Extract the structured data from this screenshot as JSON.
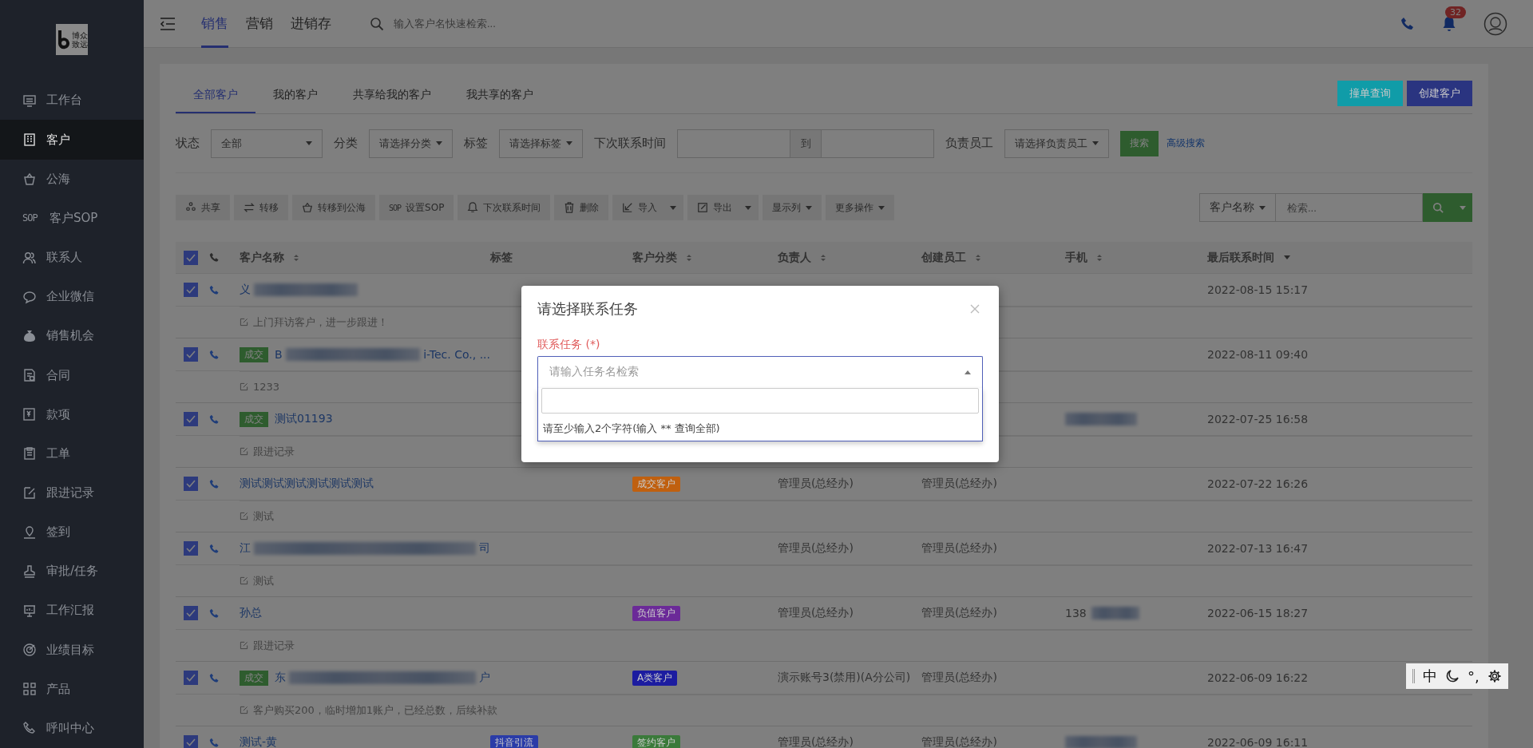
{
  "sidebar": {
    "logo_text": [
      "博众",
      "致远"
    ],
    "items": [
      {
        "label": "工作台",
        "selected": false
      },
      {
        "label": "客户",
        "selected": true
      },
      {
        "label": "公海",
        "selected": false
      },
      {
        "label": "客户SOP",
        "selected": false,
        "icon_text": "SOP"
      },
      {
        "label": "联系人",
        "selected": false
      },
      {
        "label": "企业微信",
        "selected": false
      },
      {
        "label": "销售机会",
        "selected": false
      },
      {
        "label": "合同",
        "selected": false
      },
      {
        "label": "款项",
        "selected": false
      },
      {
        "label": "工单",
        "selected": false
      },
      {
        "label": "跟进记录",
        "selected": false
      },
      {
        "label": "签到",
        "selected": false
      },
      {
        "label": "审批/任务",
        "selected": false
      },
      {
        "label": "工作汇报",
        "selected": false
      },
      {
        "label": "业绩目标",
        "selected": false
      },
      {
        "label": "产品",
        "selected": false
      },
      {
        "label": "呼叫中心",
        "selected": false
      }
    ]
  },
  "topbar": {
    "tabs": [
      {
        "label": "销售",
        "selected": true
      },
      {
        "label": "营销",
        "selected": false
      },
      {
        "label": "进销存",
        "selected": false
      }
    ],
    "search": {
      "placeholder": "输入客户名快速检索..."
    },
    "notification_count": "32"
  },
  "customer_tabs": [
    {
      "label": "全部客户",
      "selected": true
    },
    {
      "label": "我的客户",
      "selected": false
    },
    {
      "label": "共享给我的客户",
      "selected": false
    },
    {
      "label": "我共享的客户",
      "selected": false
    }
  ],
  "header_buttons": [
    {
      "label": "撞单查询",
      "color": "#109ca8"
    },
    {
      "label": "创建客户",
      "color": "#2a3480"
    }
  ],
  "filters": {
    "status": {
      "label": "状态",
      "value": "全部"
    },
    "category": {
      "label": "分类",
      "value": "请选择分类"
    },
    "tag": {
      "label": "标签",
      "value": "请选择标签"
    },
    "next_contact": {
      "label": "下次联系时间",
      "separator": "到"
    },
    "owner": {
      "label": "负责员工",
      "value": "请选择负责员工"
    },
    "search_button": "搜索",
    "advanced_link": "高级搜索"
  },
  "toolbar": [
    {
      "label": "共享",
      "kind": "plain"
    },
    {
      "label": "转移",
      "kind": "plain"
    },
    {
      "label": "转移到公海",
      "kind": "plain"
    },
    {
      "label": "设置SOP",
      "kind": "plain",
      "icon_text": "SOP"
    },
    {
      "label": "下次联系时间",
      "kind": "plain"
    },
    {
      "label": "删除",
      "kind": "plain"
    },
    {
      "label": "导入",
      "kind": "split"
    },
    {
      "label": "导出",
      "kind": "split"
    },
    {
      "label": "显示列",
      "kind": "dropdown"
    },
    {
      "label": "更多操作",
      "kind": "dropdown"
    }
  ],
  "list_search": {
    "field": "客户名称",
    "placeholder": "检索..."
  },
  "table": {
    "all_checked": true,
    "columns": [
      {
        "label": "客户名称",
        "sortable": true,
        "sorted_desc": false
      },
      {
        "label": "标签",
        "sortable": false
      },
      {
        "label": "客户分类",
        "sortable": true,
        "sorted_desc": false
      },
      {
        "label": "负责人",
        "sortable": true,
        "sorted_desc": false
      },
      {
        "label": "创建员工",
        "sortable": true,
        "sorted_desc": false
      },
      {
        "label": "手机",
        "sortable": true,
        "sorted_desc": false
      },
      {
        "label": "最后联系时间",
        "sortable": true,
        "sorted_desc": true
      }
    ],
    "rows": [
      {
        "checked": true,
        "name_start": "义",
        "redacted": true,
        "last_contact": "2022-08-15 15:17",
        "note": "上门拜访客户，进一步跟进！"
      },
      {
        "checked": true,
        "deal": "成交",
        "name_start": "B",
        "redacted": true,
        "name_end": "i-Tec. Co., ...",
        "last_contact": "2022-08-11 09:40",
        "note": "1233"
      },
      {
        "checked": true,
        "deal": "成交",
        "name_start": "测试01193",
        "phone_redacted": true,
        "last_contact": "2022-07-25 16:58",
        "note": "跟进记录"
      },
      {
        "checked": true,
        "name_start": "测试测试测试测试测试测试",
        "category": {
          "text": "成交客户",
          "color": "#c0600f"
        },
        "owner": "管理员(总经办)",
        "creator": "管理员(总经办)",
        "last_contact": "2022-07-22 16:26",
        "note": "测试"
      },
      {
        "checked": true,
        "name_start": "江",
        "redacted": true,
        "name_end": "司",
        "owner": "管理员(总经办)",
        "creator": "管理员(总经办)",
        "last_contact": "2022-07-13 16:47",
        "note": "测试"
      },
      {
        "checked": true,
        "name_start": "孙总",
        "category": {
          "text": "负值客户",
          "color": "#6b2a98"
        },
        "owner": "管理员(总经办)",
        "creator": "管理员(总经办)",
        "phone": "138",
        "phone_redacted": true,
        "last_contact": "2022-06-15 18:27",
        "note": "跟进记录"
      },
      {
        "checked": true,
        "deal": "成交",
        "name_start": "东",
        "redacted": true,
        "name_end": "户",
        "category": {
          "text": "A类客户",
          "color": "#1c1ca0"
        },
        "owner": "演示账号3(禁用)(A分公司)",
        "creator": "管理员(总经办)",
        "last_contact": "2022-06-09 16:22",
        "note": "客户购买200，临时增加1账户，已经总数，后续补款"
      },
      {
        "checked": true,
        "name_start": "测试-黄",
        "tag": {
          "text": "抖音引流",
          "color": "#2a3ca8"
        },
        "category": {
          "text": "签约客户",
          "color": "#3a7a3a"
        },
        "owner": "管理员(总经办)",
        "creator": "管理员(总经办)",
        "phone_redacted": true,
        "last_contact": "2022-06-09 16:11"
      }
    ]
  },
  "modal": {
    "title": "请选择联系任务",
    "field_label": "联系任务 (*)",
    "select_placeholder": "请输入任务名检索",
    "expanded": true,
    "hint": "请至少输入2个字符(输入 ** 查询全部)"
  },
  "ime_bar": {
    "mode": "中",
    "punctuation": "°,"
  }
}
